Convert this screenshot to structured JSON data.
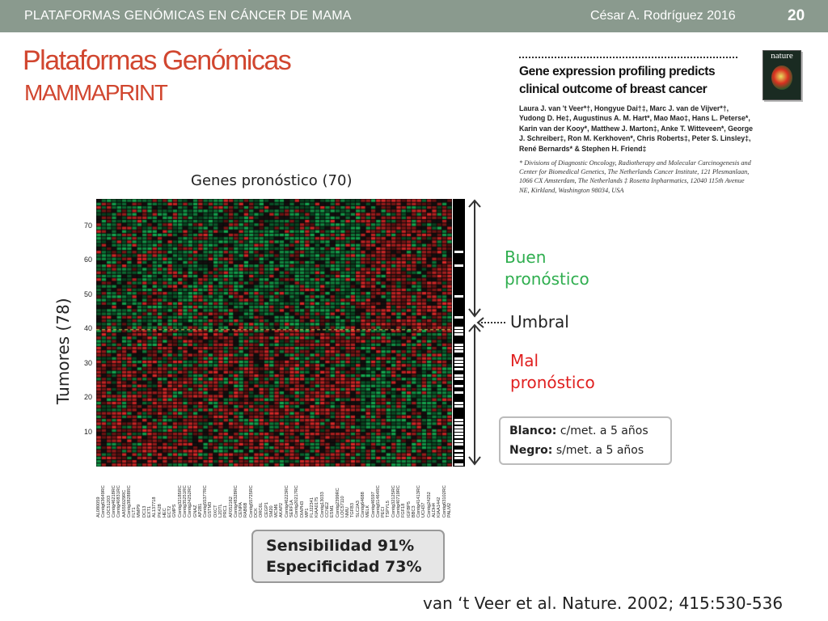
{
  "header": {
    "left_text": "PLATAFORMAS GENÓMICAS EN CÁNCER DE MAMA",
    "author_year": "César A. Rodríguez  2016",
    "slide_number": "20"
  },
  "title": {
    "line1": "Plataformas Genómicas",
    "line2": "MAMMAPRINT"
  },
  "paper": {
    "title": "Gene expression profiling predicts clinical outcome of breast cancer",
    "authors": "Laura J. van 't Veer*†, Hongyue Dai†‡, Marc J. van de Vijver*†, Yudong D. He‡, Augustinus A. M. Hart*, Mao Mao‡, Hans L. Peterse*, Karin van der Kooy*, Matthew J. Marton‡, Anke T. Witteveen*, George J. Schreiber‡, Ron M. Kerkhoven*, Chris Roberts‡, Peter S. Linsley‡, René Bernards* & Stephen H. Friend‡",
    "affiliation": "* Divisions of Diagnostic Oncology, Radiotherapy and Molecular Carcinogenesis and Center for Biomedical Genetics, The Netherlands Cancer Institute, 121 Plesmanlaan, 1066 CX Amsterdam, The Netherlands ‡ Rosetta Inpharmatics, 12040 115th Avenue NE, Kirkland, Washington 98034, USA",
    "cover_label": "nature"
  },
  "heatmap": {
    "title": "Genes pronóstico (70)",
    "y_label": "Tumores (78)",
    "y_ticks": [
      "70",
      "60",
      "50",
      "40",
      "30",
      "20",
      "10"
    ],
    "gene_labels": [
      "AL080059",
      "Contig63649RC",
      "LOC51203",
      "Contig46218RC",
      "Contig40831RC",
      "AA555029RC",
      "Contig38288RC",
      "FLT1",
      "MMP9",
      "DC13",
      "EXT1",
      "AL137718",
      "PK428",
      "HEC",
      "ECT2",
      "GMPS",
      "Contig32185RC",
      "Contig35251RC",
      "Contig24252RC",
      "GNAZ",
      "AP2B1",
      "Contig55377RC",
      "GSTM3",
      "OXCT",
      "L2DTL",
      "PRC1",
      "AF052162",
      "Contig48328RC",
      "CENPA",
      "RAB6B",
      "Contig55725RC",
      "DCK",
      "ORC6L",
      "CEGP1",
      "SM20",
      "MCM6",
      "AKAP2",
      "Contig46223RC",
      "SERF1A",
      "Contig20217RC",
      "DIAPH3",
      "MP1",
      "FLJ22341",
      "KIAA0175",
      "Contig13033",
      "CCNE2",
      "ESM1",
      "Contig2399RC",
      "LOC57110",
      "NMU",
      "TGFB3",
      "SLC2A3",
      "Contig64688",
      "MELK",
      "Contig46597",
      "Contig51464RC",
      "PECI",
      "TSPYL5",
      "Contig32125RC",
      "Contig40719RC",
      "FGF18",
      "IGFBP5",
      "BBC3",
      "Contig41413RC",
      "UCH37",
      "Contig24252",
      "ALDH4",
      "KIAA1442",
      "Contig63102RC",
      "PALM2"
    ],
    "prognosis_good": "Buen pronóstico",
    "threshold": "Umbral",
    "prognosis_bad": "Mal pronóstico",
    "colors": {
      "green": "#1fa353",
      "red": "#d62a2a",
      "black": "#140f0f"
    }
  },
  "legend": {
    "white_key": "Blanco:",
    "white_value": "c/met. a 5 años",
    "black_key": "Negro:",
    "black_value": "s/met. a 5 años"
  },
  "stats": {
    "sensitivity": "Sensibilidad 91%",
    "specificity": "Especificidad 73%"
  },
  "citation": "van ‘t Veer et al. Nature. 2002; 415:530-536"
}
